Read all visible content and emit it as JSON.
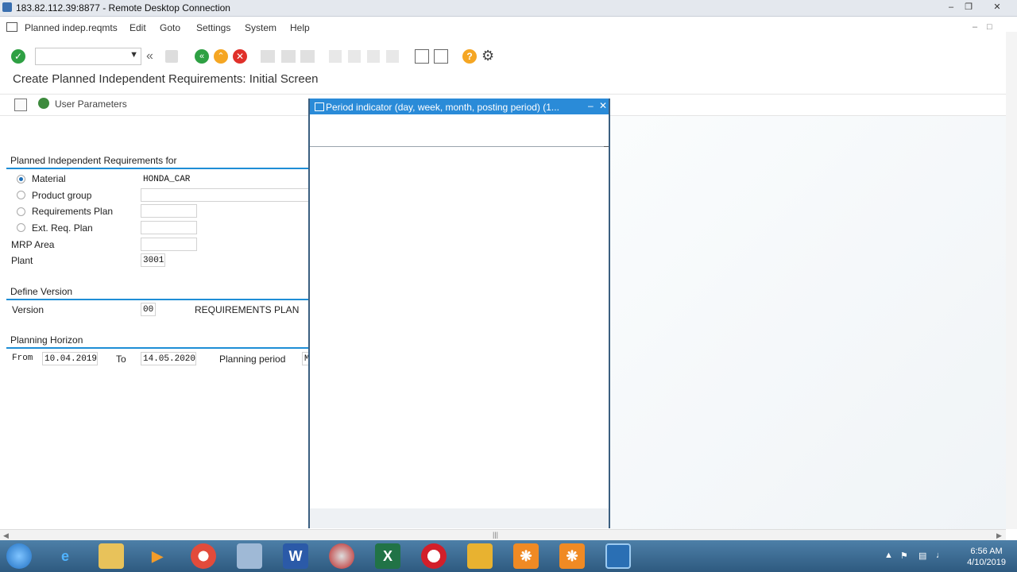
{
  "window": {
    "title": "183.82.112.39:8877 - Remote Desktop Connection",
    "min_icon": "minimize-icon",
    "restore_icon": "restore-icon",
    "close_icon": "close-icon"
  },
  "menubar": {
    "items": [
      {
        "label": "Planned indep.reqmts",
        "name": "menu-planned-indep-reqmts"
      },
      {
        "label": "Edit",
        "name": "menu-edit"
      },
      {
        "label": "Goto",
        "name": "menu-goto"
      },
      {
        "label": "Settings",
        "name": "menu-settings"
      },
      {
        "label": "System",
        "name": "menu-system"
      },
      {
        "label": "Help",
        "name": "menu-help"
      }
    ]
  },
  "toolbar": {
    "command_field_value": "",
    "icons": [
      "enter-check-icon",
      "double-chevron-left-icon",
      "save-icon",
      "back-icon",
      "exit-icon",
      "cancel-icon",
      "print-icon",
      "find-icon",
      "find-next-icon",
      "first-page-icon",
      "previous-page-icon",
      "next-page-icon",
      "last-page-icon",
      "create-session-icon",
      "shortcut-icon",
      "help-icon",
      "customize-layout-icon"
    ]
  },
  "screen": {
    "title": "Create Planned Independent Requirements: Initial Screen"
  },
  "app_toolbar": {
    "user_parameters_label": "User Parameters"
  },
  "form": {
    "group1": {
      "header": "Planned Independent Requirements for",
      "material_label": "Material",
      "material_value": "HONDA_CAR",
      "product_group_label": "Product group",
      "product_group_value": "",
      "requirements_plan_label": "Requirements Plan",
      "requirements_plan_value": "",
      "ext_req_plan_label": "Ext. Req. Plan",
      "ext_req_plan_value": "",
      "mrp_area_label": "MRP Area",
      "mrp_area_value": "",
      "plant_label": "Plant",
      "plant_value": "3001"
    },
    "group2": {
      "header": "Define Version",
      "version_label": "Version",
      "version_value": "00",
      "version_text": "REQUIREMENTS PLAN"
    },
    "group3": {
      "header": "Planning Horizon",
      "from_label": "From",
      "from_value": "10.04.2019",
      "to_label": "To",
      "to_value": "14.05.2020",
      "planning_period_label": "Planning period",
      "planning_period_value": "M"
    }
  },
  "popup": {
    "title": "Period indicator (day, week, month, posting period) (1..."
  },
  "taskbar": {
    "time": "6:56 AM",
    "date": "4/10/2019"
  },
  "colors": {
    "accent": "#1e8ed6",
    "popup_title_bg": "#2a8bd8",
    "taskbar": "#3d6d95"
  }
}
